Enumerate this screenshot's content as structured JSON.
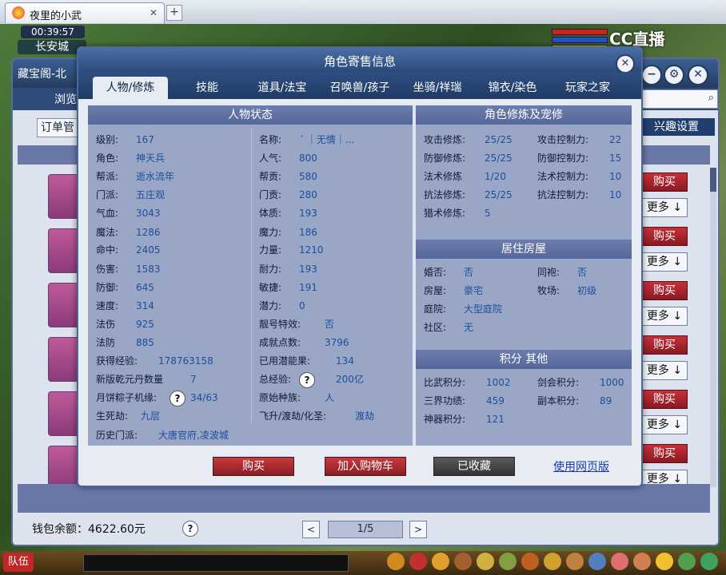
{
  "browser": {
    "tab_title": "夜里的小武",
    "tab_close": "✕",
    "new_tab": "+"
  },
  "game": {
    "clock": "00:39:57",
    "city": "长安城",
    "stream_logo": "CC直播",
    "team_button": "队伍"
  },
  "shop": {
    "title": "藏宝阁-北",
    "browse": "浏览",
    "order_button": "订单管",
    "interest_button": "兴趣设置",
    "rows": [
      {
        "buy": "购买",
        "more": "更多 ↓"
      },
      {
        "buy": "购买",
        "more": "更多 ↓"
      },
      {
        "buy": "购买",
        "more": "更多 ↓"
      },
      {
        "buy": "购买",
        "more": "更多 ↓"
      },
      {
        "buy": "购买",
        "more": "更多 ↓"
      },
      {
        "buy": "购买",
        "more": "更多 ↓"
      }
    ],
    "wallet": "钱包余额：4622.60元",
    "help": "?",
    "pager": {
      "prev": "<",
      "page": "1/5",
      "next": ">"
    },
    "window_buttons": {
      "minimize": "−",
      "settings": "⚙",
      "close": "✕"
    }
  },
  "dialog": {
    "title": "角色寄售信息",
    "close": "✕",
    "tabs": [
      "人物/修炼",
      "技能",
      "道具/法宝",
      "召唤兽/孩子",
      "坐骑/祥瑞",
      "锦衣/染色",
      "玩家之家"
    ],
    "status": {
      "header": "人物状态",
      "left": [
        {
          "label": "级别:",
          "value": "167"
        },
        {
          "label": "角色:",
          "value": "神天兵"
        },
        {
          "label": "帮派:",
          "value": "逝水流年"
        },
        {
          "label": "门派:",
          "value": "五庄观"
        },
        {
          "label": "气血:",
          "value": "3043"
        },
        {
          "label": "魔法:",
          "value": "1286"
        },
        {
          "label": "命中:",
          "value": "2405"
        },
        {
          "label": "伤害:",
          "value": "1583"
        },
        {
          "label": "防御:",
          "value": "645"
        },
        {
          "label": "速度:",
          "value": "314"
        },
        {
          "label": "法伤",
          "value": "925"
        },
        {
          "label": "法防",
          "value": "885"
        },
        {
          "label": "获得经验:",
          "value": "178763158"
        },
        {
          "label": "新版乾元丹数量",
          "value": "7"
        },
        {
          "label": "月饼粽子机缘:",
          "value": "34/63",
          "help": "?"
        },
        {
          "label": "生死劫:",
          "value": "九层"
        },
        {
          "label": "历史门派:",
          "value": "大唐官府,凌波城"
        }
      ],
      "right": [
        {
          "label": "名称:",
          "value": "ˊ ｜无情｜..."
        },
        {
          "label": "人气:",
          "value": "800"
        },
        {
          "label": "帮贡:",
          "value": "580"
        },
        {
          "label": "门贡:",
          "value": "280"
        },
        {
          "label": "体质:",
          "value": "193"
        },
        {
          "label": "魔力:",
          "value": "186"
        },
        {
          "label": "力量:",
          "value": "1210"
        },
        {
          "label": "耐力:",
          "value": "193"
        },
        {
          "label": "敏捷:",
          "value": "191"
        },
        {
          "label": "潜力:",
          "value": "0"
        },
        {
          "label": "靓号特效:",
          "value": "否"
        },
        {
          "label": "成就点数:",
          "value": "3796"
        },
        {
          "label": "已用潜能果:",
          "value": "134"
        },
        {
          "label": "总经验:",
          "value": "200亿",
          "help": "?"
        },
        {
          "label": "原始种族:",
          "value": "人"
        },
        {
          "label": "飞升/渡劫/化圣:",
          "value": "渡劫"
        }
      ]
    },
    "cultivation": {
      "header": "角色修炼及宠修",
      "left": [
        {
          "label": "攻击修炼:",
          "value": "25/25"
        },
        {
          "label": "防御修炼:",
          "value": "25/25"
        },
        {
          "label": "法术修炼",
          "value": "1/20"
        },
        {
          "label": "抗法修炼:",
          "value": "25/25"
        },
        {
          "label": "猎术修炼:",
          "value": "5"
        }
      ],
      "right": [
        {
          "label": "攻击控制力:",
          "value": "22"
        },
        {
          "label": "防御控制力:",
          "value": "15"
        },
        {
          "label": "法术控制力:",
          "value": "10"
        },
        {
          "label": "抗法控制力:",
          "value": "10"
        }
      ]
    },
    "house": {
      "header": "居住房屋",
      "left": [
        {
          "label": "婚否:",
          "value": "否"
        },
        {
          "label": "房屋:",
          "value": "豪宅"
        },
        {
          "label": "庭院:",
          "value": "大型庭院"
        },
        {
          "label": "社区:",
          "value": "无"
        }
      ],
      "right": [
        {
          "label": "同袍:",
          "value": "否"
        },
        {
          "label": "牧场:",
          "value": "初级"
        }
      ]
    },
    "points": {
      "header": "积分 其他",
      "left": [
        {
          "label": "比武积分:",
          "value": "1002"
        },
        {
          "label": "三界功绩:",
          "value": "459"
        },
        {
          "label": "神器积分:",
          "value": "121"
        }
      ],
      "right": [
        {
          "label": "剑会积分:",
          "value": "1000"
        },
        {
          "label": "副本积分:",
          "value": "89"
        }
      ]
    },
    "buttons": {
      "buy": "购买",
      "add_cart": "加入购物车",
      "favorited": "已收藏",
      "web_version": "使用网页版"
    }
  }
}
